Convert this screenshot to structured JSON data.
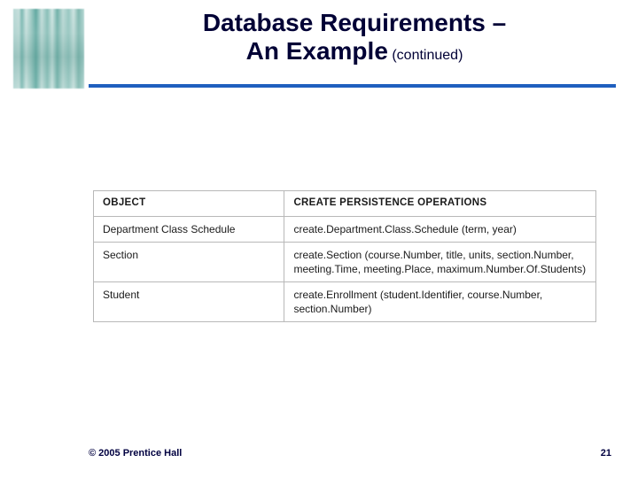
{
  "title": {
    "line1": "Database Requirements –",
    "line2_main": "An Example",
    "line2_sub": "(continued)"
  },
  "table": {
    "headers": {
      "object": "OBJECT",
      "operations": "CREATE PERSISTENCE OPERATIONS"
    },
    "rows": [
      {
        "object": "Department Class Schedule",
        "operations": "create.Department.Class.Schedule (term, year)"
      },
      {
        "object": "Section",
        "operations": "create.Section (course.Number, title, units, section.Number, meeting.Time, meeting.Place, maximum.Number.Of.Students)"
      },
      {
        "object": "Student",
        "operations": "create.Enrollment (student.Identifier, course.Number, section.Number)"
      }
    ]
  },
  "footer": {
    "copyright": "© 2005  Prentice Hall",
    "page": "21"
  }
}
